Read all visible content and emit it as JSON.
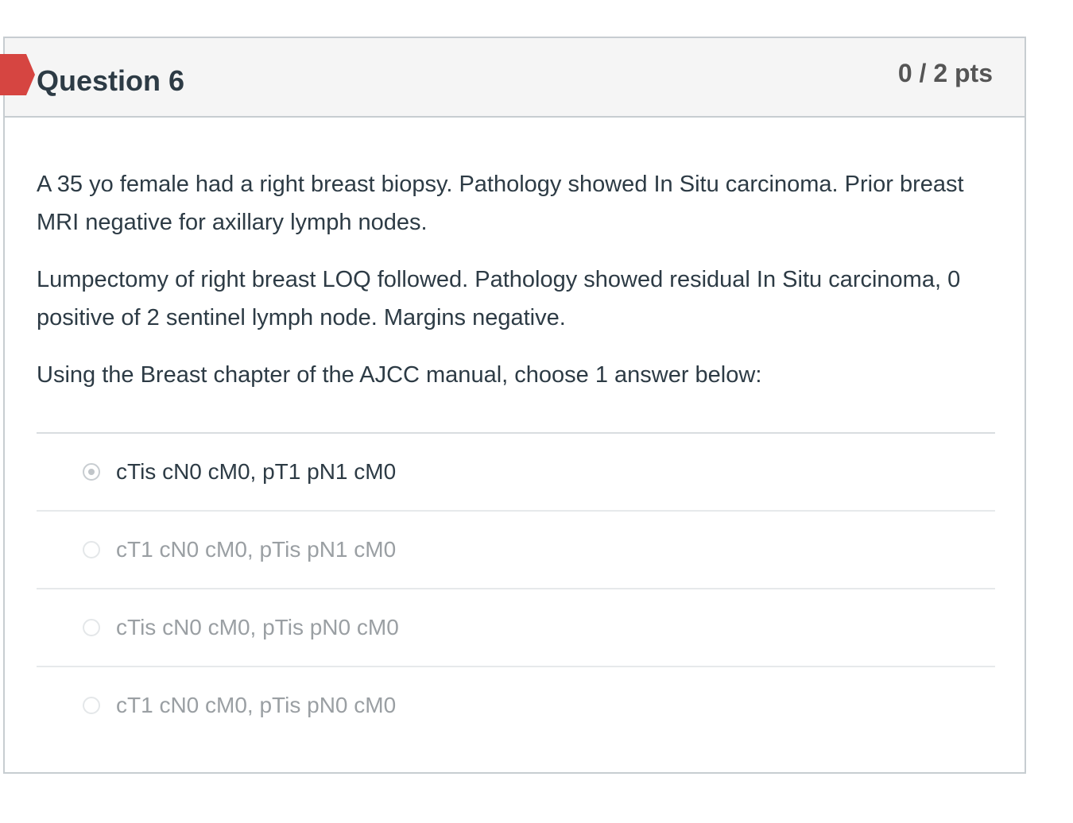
{
  "question": {
    "title": "Question 6",
    "points": "0 / 2 pts",
    "status_color": "#d64541",
    "paragraphs": [
      "A 35 yo female had a right breast biopsy.  Pathology showed In Situ carcinoma.  Prior breast MRI negative for axillary lymph nodes.",
      "Lumpectomy of right breast LOQ followed.  Pathology showed residual In Situ carcinoma, 0 positive of 2 sentinel lymph node.  Margins negative.",
      "Using the Breast chapter of the AJCC manual, choose 1 answer below:"
    ]
  },
  "answers": [
    {
      "label": "cTis cN0 cM0, pT1 pN1 cM0",
      "selected": true
    },
    {
      "label": "cT1 cN0 cM0, pTis pN1 cM0",
      "selected": false
    },
    {
      "label": "cTis cN0 cM0, pTis pN0 cM0",
      "selected": false
    },
    {
      "label": "cT1 cN0 cM0, pTis pN0 cM0",
      "selected": false
    }
  ]
}
